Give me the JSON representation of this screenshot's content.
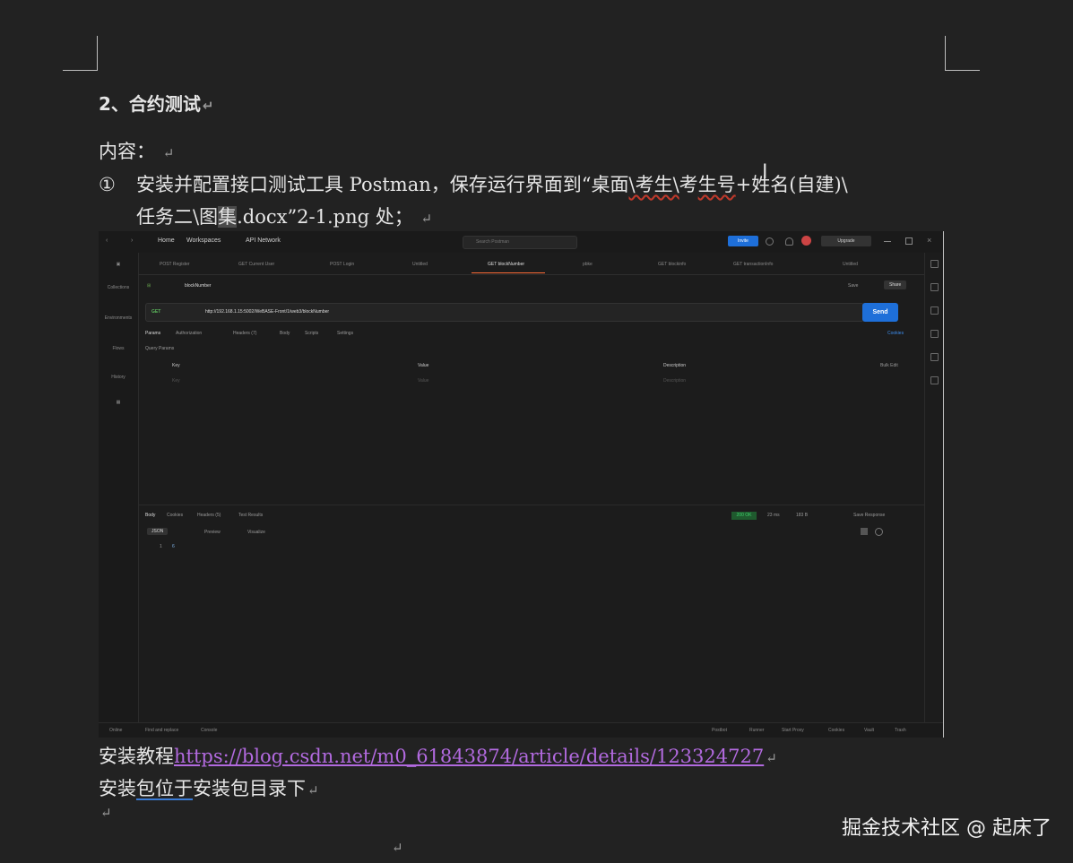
{
  "doc": {
    "heading": "2、合约测试",
    "content_label": "内容：",
    "item_number": "①",
    "item_part1": "安装并配置接口测试工具 Postman，保存运行界面到“桌面",
    "item_squig1": "\\考生\\",
    "item_part2": "考",
    "item_squig2": "生号",
    "item_part3": "+姓名(自建)\\",
    "item_line2_a": "任务二\\图",
    "item_line2_sel": "集",
    "item_line2_b": ".docx”2-1.png 处；",
    "tutorial_label": "安装教程",
    "tutorial_link": "https://blog.csdn.net/m0_61843874/article/details/123324727",
    "package_pre": "安装",
    "package_mid": "包位于",
    "package_post": "安装包目录下",
    "paragraph_mark": "↵",
    "cursor": "I"
  },
  "watermark": "掘金技术社区 @ 起床了",
  "postman": {
    "topbar": {
      "nav_back": "‹",
      "nav_forward": "›",
      "home": "Home",
      "workspaces": "Workspaces",
      "api_network": "API Network",
      "search_placeholder": "Search Postman",
      "invite": "Invite",
      "upgrade": "Upgrade"
    },
    "tabs": [
      "POST Register",
      "GET Current User",
      "POST Login",
      "Untitled",
      "GET blockNumber",
      "pbke",
      "GET blockinfo",
      "GET transactionInfo",
      "Untitled"
    ],
    "sidebar": [
      "Collections",
      "Environments",
      "Flows",
      "History"
    ],
    "request": {
      "breadcrumb": "blockNumber",
      "save": "Save",
      "share": "Share",
      "method": "GET",
      "url": "http://192.168.1.15:5002/WeBASE-Front/1/web3/blockNumber",
      "send": "Send",
      "subtabs": [
        "Params",
        "Authorization",
        "Headers (7)",
        "Body",
        "Scripts",
        "Settings"
      ],
      "cookies": "Cookies",
      "query_params": "Query Params",
      "col_key": "Key",
      "col_value": "Value",
      "col_description": "Description",
      "bulk_edit": "Bulk Edit",
      "ph_key": "Key",
      "ph_value": "Value",
      "ph_description": "Description"
    },
    "response": {
      "tabs": [
        "Body",
        "Cookies",
        "Headers (5)",
        "Test Results"
      ],
      "status": "200 OK",
      "time": "23 ms",
      "size": "183 B",
      "save_response": "Save Response",
      "format": "JSON",
      "preview": "Preview",
      "visualize": "Visualize",
      "line_number": "1",
      "line_value": "6"
    },
    "bottombar": [
      "Online",
      "Find and replace",
      "Console",
      "Postbot",
      "Runner",
      "Start Proxy",
      "Cookies",
      "Vault",
      "Trash"
    ]
  }
}
